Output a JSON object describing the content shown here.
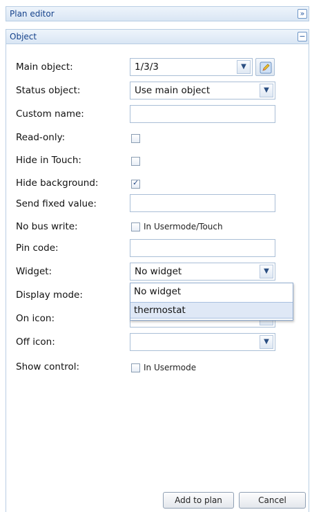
{
  "header": {
    "title": "Plan editor",
    "collapse_icon": "double-chevron-right-icon",
    "collapse_glyph": "»"
  },
  "section": {
    "title": "Object",
    "collapse_icon": "minus-icon",
    "collapse_glyph": "−"
  },
  "form": {
    "main_object": {
      "label": "Main object:",
      "value": "1/3/3"
    },
    "status_object": {
      "label": "Status object:",
      "value": "Use main object"
    },
    "custom_name": {
      "label": "Custom name:",
      "value": ""
    },
    "read_only": {
      "label": "Read-only:",
      "checked": false
    },
    "hide_in_touch": {
      "label": "Hide in Touch:",
      "checked": false
    },
    "hide_background": {
      "label": "Hide background:",
      "checked": true
    },
    "send_fixed_value": {
      "label": "Send fixed value:",
      "value": ""
    },
    "no_bus_write": {
      "label": "No bus write:",
      "checkbox_label": "In Usermode/Touch",
      "checked": false
    },
    "pin_code": {
      "label": "Pin code:",
      "value": ""
    },
    "widget": {
      "label": "Widget:",
      "value": "No widget",
      "options": [
        "No widget",
        "thermostat"
      ],
      "highlighted": "thermostat"
    },
    "display_mode": {
      "label": "Display mode:"
    },
    "on_icon": {
      "label": "On icon:",
      "value": ""
    },
    "off_icon": {
      "label": "Off icon:",
      "value": ""
    },
    "show_control": {
      "label": "Show control:",
      "checkbox_label": "In Usermode",
      "checked": false
    }
  },
  "buttons": {
    "add": "Add to plan",
    "cancel": "Cancel"
  },
  "colors": {
    "header_border": "#b8cde3",
    "header_text": "#15428b",
    "accent_highlight": "#dfe8f6"
  }
}
